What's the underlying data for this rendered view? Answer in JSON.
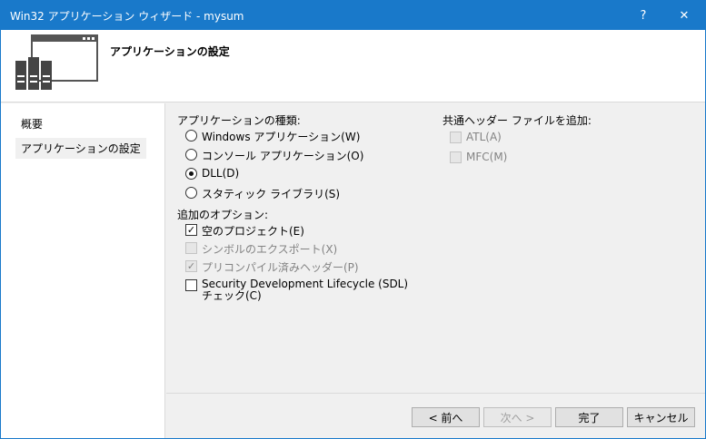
{
  "window": {
    "title": "Win32 アプリケーション ウィザード - mysum",
    "help_glyph": "?",
    "close_glyph": "✕"
  },
  "header": {
    "title": "アプリケーションの設定",
    "icon": "application-window-icon"
  },
  "sidebar": {
    "items": [
      {
        "label": "概要",
        "selected": false
      },
      {
        "label": "アプリケーションの設定",
        "selected": true
      }
    ]
  },
  "app_type": {
    "label": "アプリケーションの種類:",
    "options": [
      {
        "label": "Windows アプリケーション(W)",
        "selected": false
      },
      {
        "label": "コンソール アプリケーション(O)",
        "selected": false
      },
      {
        "label": "DLL(D)",
        "selected": true
      },
      {
        "label": "スタティック ライブラリ(S)",
        "selected": false
      }
    ]
  },
  "additional_options": {
    "label": "追加のオプション:",
    "options": [
      {
        "label": "空のプロジェクト(E)",
        "checked": true,
        "enabled": true
      },
      {
        "label": "シンボルのエクスポート(X)",
        "checked": false,
        "enabled": false
      },
      {
        "label": "プリコンパイル済みヘッダー(P)",
        "checked": true,
        "enabled": false
      },
      {
        "label": "Security Development Lifecycle (SDL) チェック(C)",
        "checked": false,
        "enabled": true
      }
    ]
  },
  "common_headers": {
    "label": "共通ヘッダー ファイルを追加:",
    "options": [
      {
        "label": "ATL(A)",
        "checked": false,
        "enabled": false
      },
      {
        "label": "MFC(M)",
        "checked": false,
        "enabled": false
      }
    ]
  },
  "buttons": {
    "back": "< 前へ",
    "next": "次へ >",
    "finish": "完了",
    "cancel": "キャンセル"
  },
  "colors": {
    "titlebar": "#1979ca",
    "panel": "#f0f0f0",
    "disabled_text": "#838383"
  }
}
